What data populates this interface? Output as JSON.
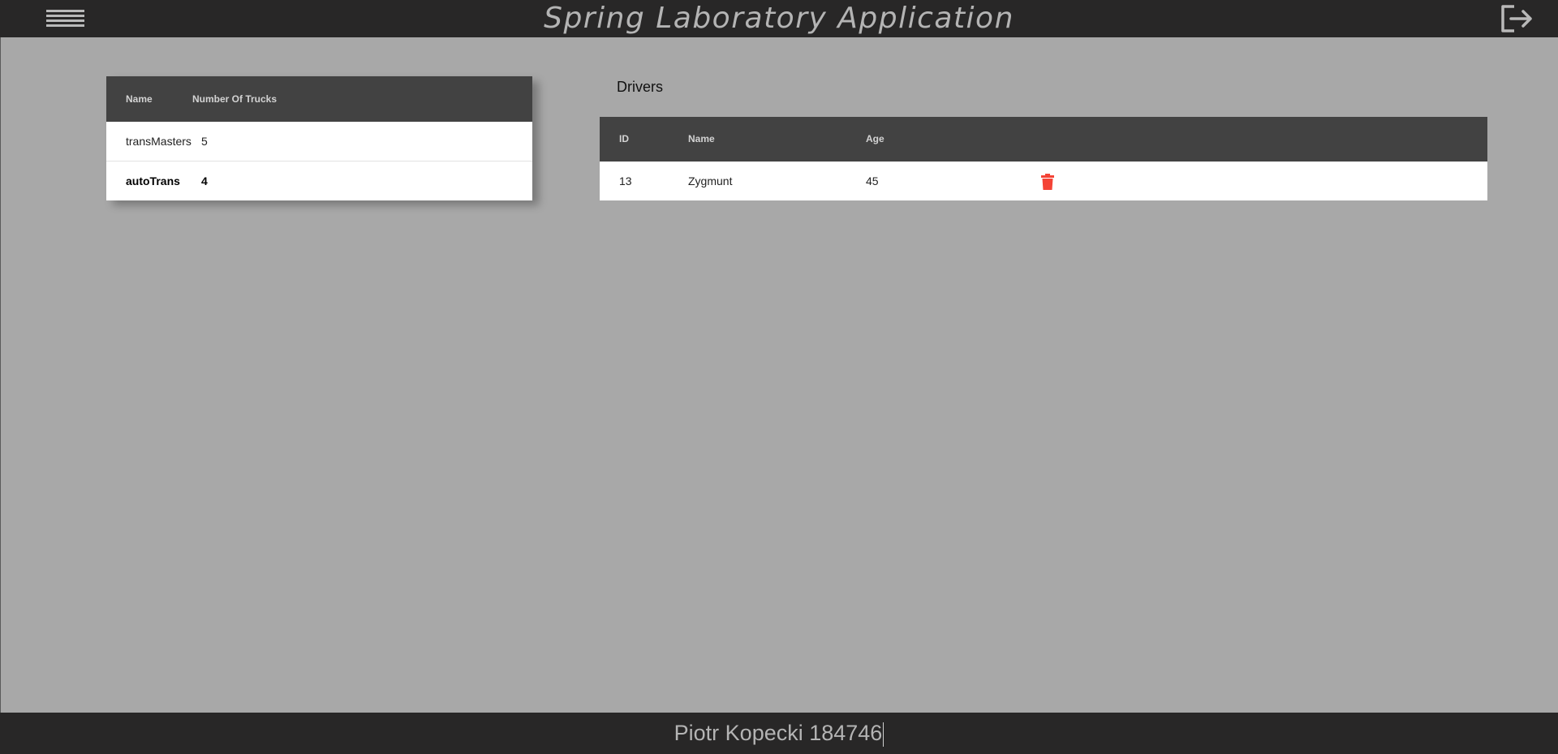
{
  "header": {
    "title": "Spring Laboratory Application",
    "menu_icon": "hamburger-menu-icon",
    "logout_icon": "logout-icon"
  },
  "companies_table": {
    "columns": [
      "Name",
      "Number Of Trucks"
    ],
    "rows": [
      {
        "name": "transMasters",
        "trucks": "5",
        "selected": false
      },
      {
        "name": "autoTrans",
        "trucks": "4",
        "selected": true
      }
    ]
  },
  "drivers": {
    "title": "Drivers",
    "columns": [
      "ID",
      "Name",
      "Age"
    ],
    "rows": [
      {
        "id": "13",
        "name": "Zygmunt",
        "age": "45",
        "action_icon": "trash-icon"
      }
    ]
  },
  "footer": {
    "text": "Piotr Kopecki 184746"
  },
  "colors": {
    "topbar": "#282727",
    "background": "#a8a8a8",
    "table_header": "#424242",
    "delete_accent": "#f44336"
  }
}
